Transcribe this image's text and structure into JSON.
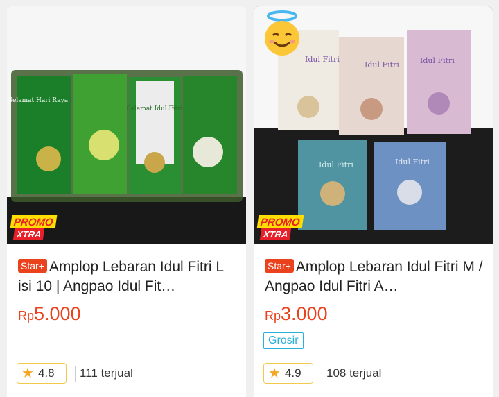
{
  "products": [
    {
      "promo_line1": "PROMO",
      "promo_line2": "XTRA",
      "badge": "Star+",
      "title": "Amplop Lebaran Idul Fitri L isi 10 | Angpao Idul Fit…",
      "currency": "Rp",
      "price": "5.000",
      "rating": "4.8",
      "sold": "111 terjual",
      "image_text": [
        "Selamat Hari Raya",
        "Selamat Idul Fitri"
      ]
    },
    {
      "promo_line1": "PROMO",
      "promo_line2": "XTRA",
      "badge": "Star+",
      "title": "Amplop Lebaran Idul Fitri M / Angpao Idul Fitri A…",
      "currency": "Rp",
      "price": "3.000",
      "tag": "Grosir",
      "rating": "4.9",
      "sold": "108 terjual",
      "image_text": [
        "Idul Fitri"
      ]
    }
  ],
  "colors": {
    "accent": "#e9421d",
    "tag": "#2ab0d9",
    "star": "#f5a623",
    "promo_yellow": "#ffde00",
    "promo_red": "#e8202a"
  },
  "icons": {
    "rating": "star-icon",
    "overlay": "smiling-face-with-halo-icon"
  }
}
